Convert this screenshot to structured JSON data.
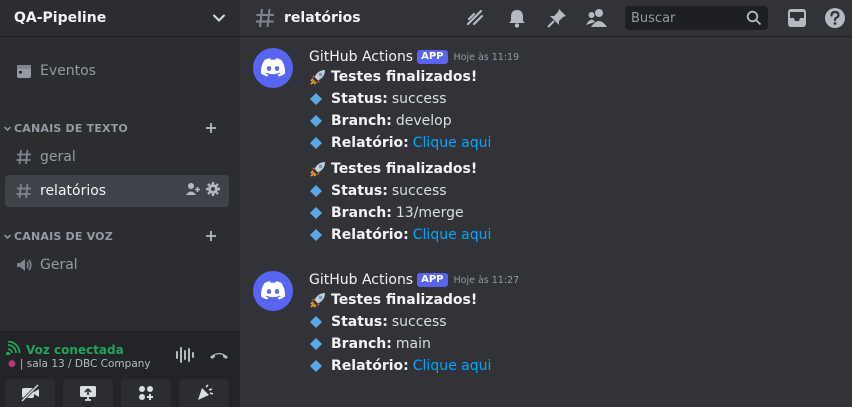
{
  "server": {
    "name": "QA-Pipeline"
  },
  "sidebar": {
    "events_label": "Eventos",
    "text_category": "CANAIS DE TEXTO",
    "text_channels": [
      {
        "name": "geral"
      },
      {
        "name": "relatórios"
      }
    ],
    "voice_category": "CANAIS DE VOZ",
    "voice_channels": [
      {
        "name": "Geral"
      }
    ]
  },
  "voice": {
    "status": "Voz conectada",
    "detail": "| sala 13 / DBC Company"
  },
  "header": {
    "channel": "relatórios",
    "search_placeholder": "Buscar"
  },
  "messages": [
    {
      "author": "GitHub Actions",
      "badge": "APP",
      "timestamp": "Hoje às 11:19",
      "blocks": [
        {
          "title": "Testes finalizados!",
          "status_label": "Status:",
          "status": "success",
          "branch_label": "Branch:",
          "branch": "develop",
          "report_label": "Relatório:",
          "report_link": "Clique aqui"
        },
        {
          "title": "Testes finalizados!",
          "status_label": "Status:",
          "status": "success",
          "branch_label": "Branch:",
          "branch": "13/merge",
          "report_label": "Relatório:",
          "report_link": "Clique aqui"
        }
      ]
    },
    {
      "author": "GitHub Actions",
      "badge": "APP",
      "timestamp": "Hoje às 11:27",
      "blocks": [
        {
          "title": "Testes finalizados!",
          "status_label": "Status:",
          "status": "success",
          "branch_label": "Branch:",
          "branch": "main",
          "report_label": "Relatório:",
          "report_link": "Clique aqui"
        }
      ]
    }
  ],
  "colors": {
    "accent": "#5865f2",
    "link": "#00a8fc",
    "voice_connected": "#23a559",
    "diamond": "#5aa9e6"
  },
  "icons": [
    "chevron-down-icon",
    "calendar-icon",
    "hash-icon",
    "add-member-icon",
    "gear-icon",
    "speaker-icon",
    "plus-icon",
    "threads-icon",
    "bell-icon",
    "pin-icon",
    "members-icon",
    "search-icon",
    "inbox-icon",
    "help-icon",
    "discord-logo-icon",
    "rocket-icon",
    "diamond-icon",
    "signal-icon",
    "soundwave-icon",
    "hangup-icon",
    "camera-off-icon",
    "screen-share-icon",
    "activities-icon",
    "soundboard-icon"
  ]
}
